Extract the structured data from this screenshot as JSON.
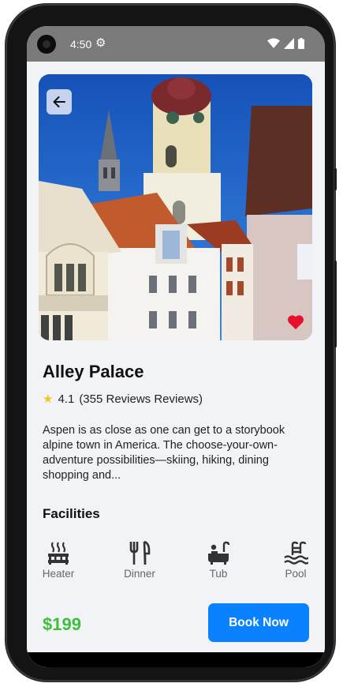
{
  "status_bar": {
    "time": "4:50",
    "settings_icon": "gear-icon",
    "icons": [
      "wifi-icon",
      "signal-icon",
      "battery-icon"
    ]
  },
  "hero": {
    "back_icon": "arrow-left-icon",
    "favorite_icon": "heart-icon",
    "favorite_color": "#e8112d"
  },
  "hotel": {
    "name": "Alley Palace",
    "rating": "4.1",
    "reviews": "(355 Reviews Reviews)",
    "description": "Aspen is as close as one can get to a storybook alpine town in America. The choose-your-own-adventure possibilities—skiing, hiking, dining shopping and..."
  },
  "facilities": {
    "title": "Facilities",
    "items": [
      {
        "label": "Heater",
        "icon": "heater-icon"
      },
      {
        "label": "Dinner",
        "icon": "dinner-icon"
      },
      {
        "label": "Tub",
        "icon": "tub-icon"
      },
      {
        "label": "Pool",
        "icon": "pool-icon"
      }
    ]
  },
  "footer": {
    "price": "$199",
    "book_label": "Book Now",
    "price_color": "#3cc13b",
    "button_color": "#0a82ff"
  }
}
